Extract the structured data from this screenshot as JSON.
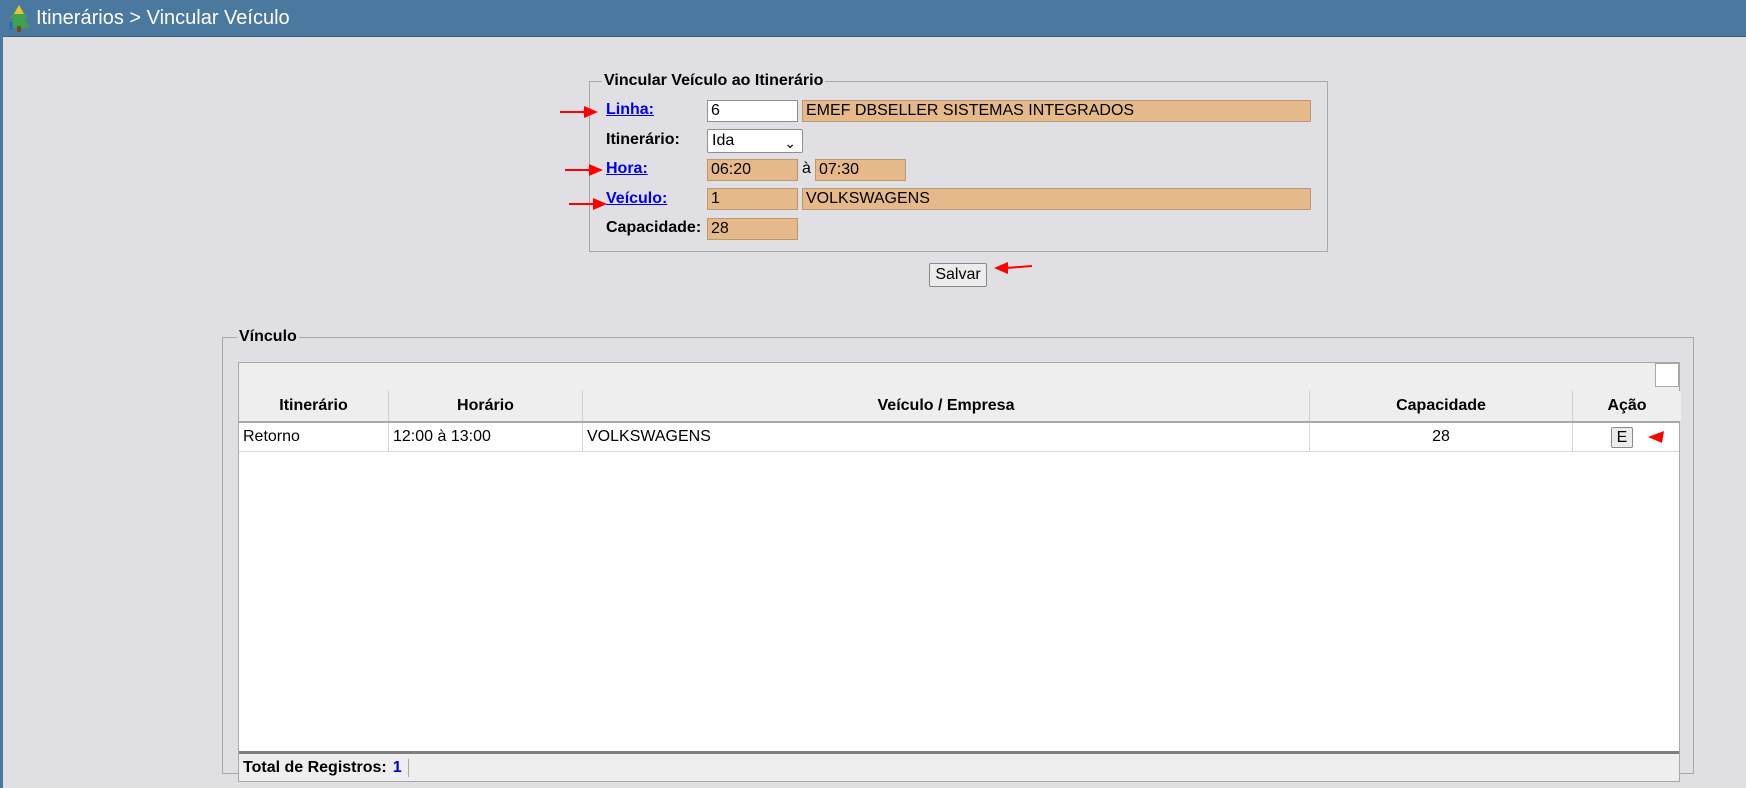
{
  "window": {
    "title": "Itinerários > Vincular Veículo",
    "logo_icon": "tree-logo-icon"
  },
  "form": {
    "legend": "Vincular Veículo ao Itinerário",
    "linha": {
      "label": "Linha:",
      "code": "6",
      "name": "EMEF DBSELLER SISTEMAS INTEGRADOS"
    },
    "itinerario": {
      "label": "Itinerário:",
      "selected": "Ida"
    },
    "hora": {
      "label": "Hora:",
      "start": "06:20",
      "separator": "à",
      "end": "07:30"
    },
    "veiculo": {
      "label": "Veículo:",
      "code": "1",
      "name": "VOLKSWAGENS"
    },
    "capacidade": {
      "label": "Capacidade:",
      "value": "28"
    },
    "save_label": "Salvar"
  },
  "grid": {
    "legend": "Vínculo",
    "columns": [
      "Itinerário",
      "Horário",
      "Veículo / Empresa",
      "Capacidade",
      "Ação"
    ],
    "rows": [
      {
        "itinerario": "Retorno",
        "horario": "12:00 à 13:00",
        "veiculo": "VOLKSWAGENS",
        "capacidade": "28",
        "acao": "E"
      }
    ],
    "footer": {
      "label": "Total de Registros:",
      "count": "1"
    }
  },
  "colors": {
    "titlebar": "#4a789e",
    "readonly_field": "#e6b98b",
    "link": "#0000ee",
    "annotation_arrow": "#ff0000"
  }
}
